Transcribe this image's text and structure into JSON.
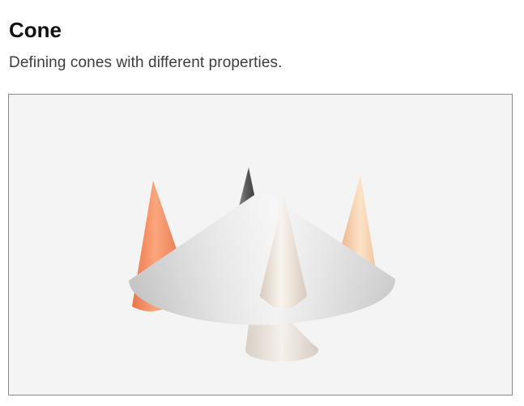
{
  "page": {
    "title": "Cone",
    "subtitle": "Defining cones with different properties."
  },
  "scene": {
    "background_color": "#f4f4f4",
    "border_color": "#8a8a8a",
    "objects": [
      {
        "name": "dark-cone",
        "color": "#555555"
      },
      {
        "name": "orange-cone",
        "color": "#f08a5d"
      },
      {
        "name": "peach-cone",
        "color": "#f6cca3"
      },
      {
        "name": "large-silver-cone",
        "color": "#d8d8d8"
      },
      {
        "name": "ivory-front-cone",
        "color": "#eae0d6"
      },
      {
        "name": "bottom-truncated-cone",
        "color": "#e8e2dc"
      }
    ]
  }
}
